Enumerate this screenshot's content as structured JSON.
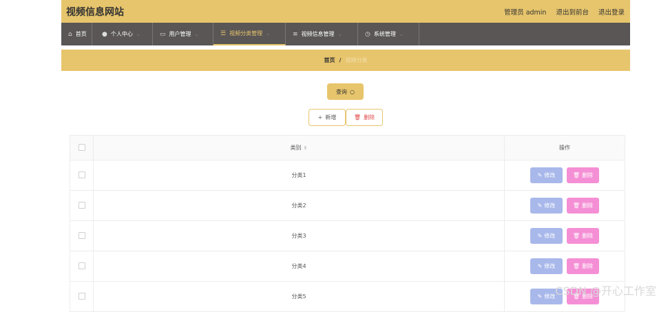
{
  "header": {
    "site_title": "视频信息网站",
    "user_label": "管理员 admin",
    "front_link": "退出到前台",
    "logout_link": "退出登录"
  },
  "nav": {
    "items": [
      {
        "label": "首页",
        "icon": "home-icon"
      },
      {
        "label": "个人中心",
        "icon": "user-icon"
      },
      {
        "label": "用户管理",
        "icon": "id-card-icon"
      },
      {
        "label": "视频分类管理",
        "icon": "sliders-icon"
      },
      {
        "label": "视频信息管理",
        "icon": "list-icon"
      },
      {
        "label": "系统管理",
        "icon": "clock-icon"
      }
    ]
  },
  "breadcrumb": {
    "home": "首页",
    "separator": "/",
    "current": "视频分类"
  },
  "actions": {
    "query_label": "查询",
    "add_label": "新增",
    "delete_label": "删除"
  },
  "table": {
    "headers": {
      "category": "类别",
      "operation": "操作"
    },
    "rows": [
      {
        "category": "分类1"
      },
      {
        "category": "分类2"
      },
      {
        "category": "分类3"
      },
      {
        "category": "分类4"
      },
      {
        "category": "分类5"
      }
    ],
    "row_actions": {
      "edit": "修改",
      "delete": "删除"
    }
  },
  "watermark": "CSDN @开心工作室",
  "colors": {
    "accent": "#e7c56c",
    "nav_bg": "#5a5656",
    "edit": "#a9b8ea",
    "delete": "#f58fd5"
  }
}
